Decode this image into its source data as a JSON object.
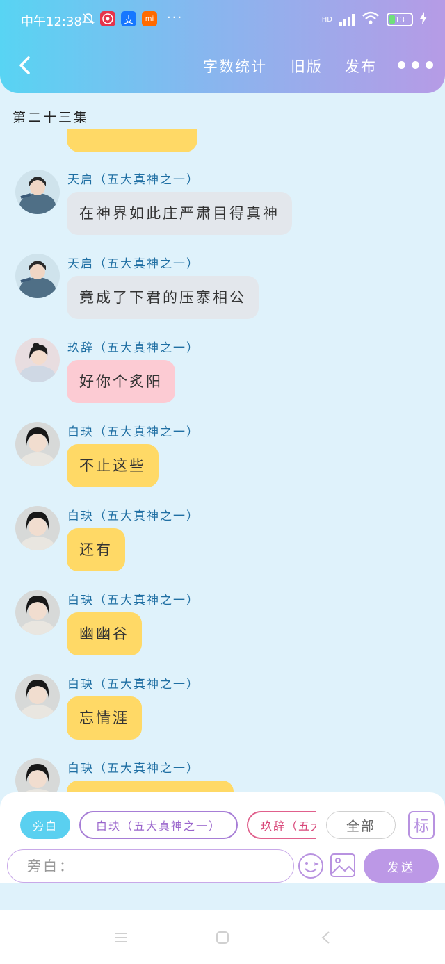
{
  "status_bar": {
    "time": "中午12:38",
    "app_icon_2": "支",
    "app_icon_3": "mi",
    "overflow": "···",
    "network": "HD",
    "battery": "13"
  },
  "nav": {
    "word_count": "字数统计",
    "old_version": "旧版",
    "publish": "发布"
  },
  "episode_title": "第二十三集",
  "messages": [
    {
      "sender": "天启（五大真神之一）",
      "text": "在神界如此庄严肃目得真神",
      "color": "#e3e7ec"
    },
    {
      "sender": "天启（五大真神之一）",
      "text": "竟成了下君的压寨相公",
      "color": "#e3e7ec"
    },
    {
      "sender": "玖辞（五大真神之一）",
      "text": "好你个炙阳",
      "color": "#fccbd3"
    },
    {
      "sender": "白玦（五大真神之一）",
      "text": "不止这些",
      "color": "#ffd966"
    },
    {
      "sender": "白玦（五大真神之一）",
      "text": "还有",
      "color": "#ffd966"
    },
    {
      "sender": "白玦（五大真神之一）",
      "text": "幽幽谷",
      "color": "#ffd966"
    },
    {
      "sender": "白玦（五大真神之一）",
      "text": "忘情涯",
      "color": "#ffd966"
    },
    {
      "sender": "白玦（五大真神之一）",
      "text": "",
      "color": "#ffd966"
    }
  ],
  "composer": {
    "chips": [
      "旁白",
      "白玦（五大真神之一）",
      "玖辞（五大真神之一）",
      "全部"
    ],
    "mark_label": "标",
    "input_placeholder": "旁白：",
    "input_value": "",
    "send_label": "发送"
  },
  "colors": {
    "accent": "#bc98e6",
    "narration_chip": "#5ad0f0",
    "background": "#dff2fb"
  },
  "icons": [
    "back-icon",
    "more-icon",
    "emoji-icon",
    "image-icon",
    "menu-icon",
    "home-icon",
    "back-triangle-icon"
  ]
}
